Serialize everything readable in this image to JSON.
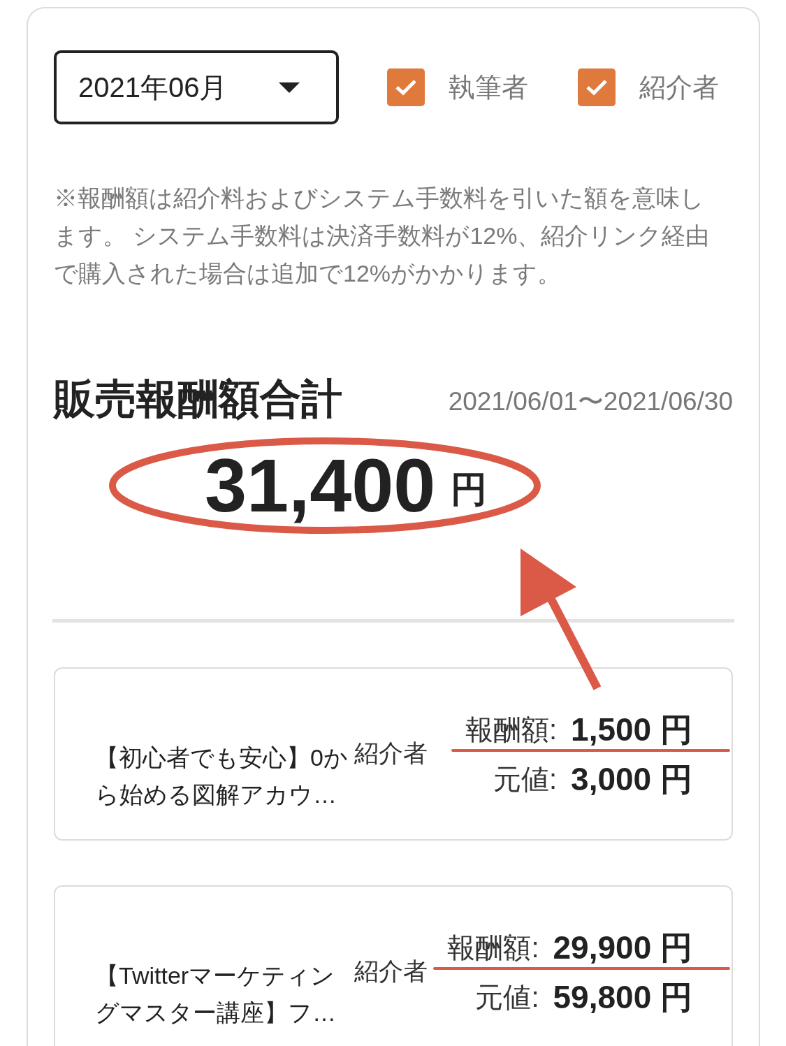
{
  "month_select": {
    "value": "2021年06月"
  },
  "filters": [
    {
      "label": "執筆者",
      "checked": true
    },
    {
      "label": "紹介者",
      "checked": true
    }
  ],
  "note": "※報酬額は紹介料およびシステム手数料を引いた額を意味します。 システム手数料は決済手数料が12%、紹介リンク経由で購入された場合は追加で12%がかかります。",
  "summary": {
    "title": "販売報酬額合計",
    "period": "2021/06/01〜2021/06/30",
    "amount": "31,400",
    "unit": "円",
    "circled": true,
    "arrow": true
  },
  "sales": [
    {
      "title": "【初心者でも安心】0から始める図解アカウ…",
      "role": "紹介者",
      "reward_label": "報酬額:",
      "reward": "1,500 円",
      "reward_underlined": true,
      "price_label": "元値:",
      "price": "3,000 円"
    },
    {
      "title": "【Twitterマーケティングマスター講座】フ…",
      "role": "紹介者",
      "reward_label": "報酬額:",
      "reward": "29,900 円",
      "reward_underlined": true,
      "price_label": "元値:",
      "price": "59,800 円"
    }
  ]
}
